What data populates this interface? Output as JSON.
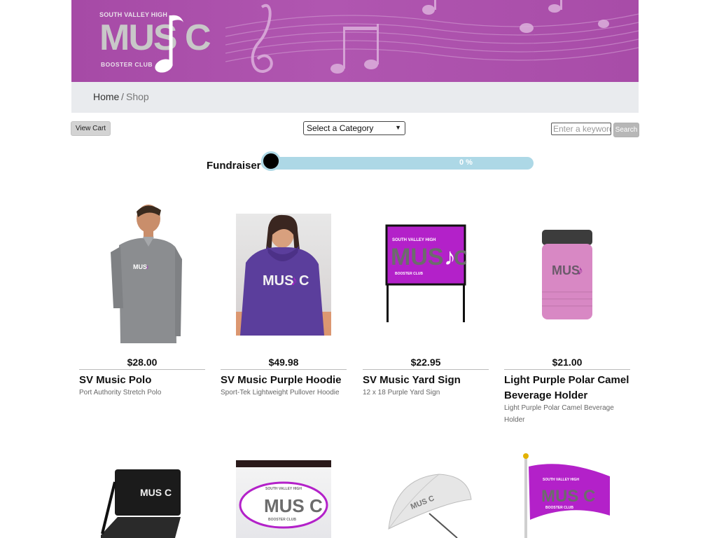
{
  "banner": {
    "logo_top": "SOUTH VALLEY HIGH",
    "logo_word": "MUS C",
    "logo_bottom": "BOOSTER CLUB"
  },
  "breadcrumb": {
    "home": "Home",
    "separator": "/",
    "current": "Shop"
  },
  "toolbar": {
    "view_cart": "View Cart",
    "category_selected": "Select a Category",
    "keyword_placeholder": "Enter a keyword",
    "search": "Search"
  },
  "fundraiser": {
    "label": "Fundraiser",
    "percent_text": "0 %",
    "progress_fraction": 0.0
  },
  "products": [
    {
      "price": "$28.00",
      "name": "SV Music Polo",
      "desc": "Port Authority Stretch Polo",
      "icon": "polo-shirt"
    },
    {
      "price": "$49.98",
      "name": "SV Music Purple Hoodie",
      "desc": "Sport-Tek Lightweight Pullover Hoodie",
      "icon": "hoodie"
    },
    {
      "price": "$22.95",
      "name": "SV Music Yard Sign",
      "desc": "12 x 18 Purple Yard Sign",
      "icon": "yard-sign"
    },
    {
      "price": "$21.00",
      "name": "Light Purple Polar Camel Beverage Holder",
      "desc": "Light Purple Polar Camel Beverage Holder",
      "icon": "can-cooler"
    }
  ],
  "second_row": [
    {
      "icon": "stadium-seat",
      "logo": "MUS C"
    },
    {
      "icon": "oval-sticker",
      "logo": "MUS C",
      "top": "SOUTH VALLEY HIGH",
      "bottom": "BOOSTER CLUB"
    },
    {
      "icon": "umbrella",
      "logo": "MUS C"
    },
    {
      "icon": "flag",
      "logo": "MUS C",
      "top": "SOUTH VALLEY HIGH",
      "bottom": "BOOSTER CLUB"
    }
  ],
  "colors": {
    "brand_purple": "#a64aa6",
    "sign_magenta": "#b321c9",
    "progress_track": "#add8e6"
  }
}
